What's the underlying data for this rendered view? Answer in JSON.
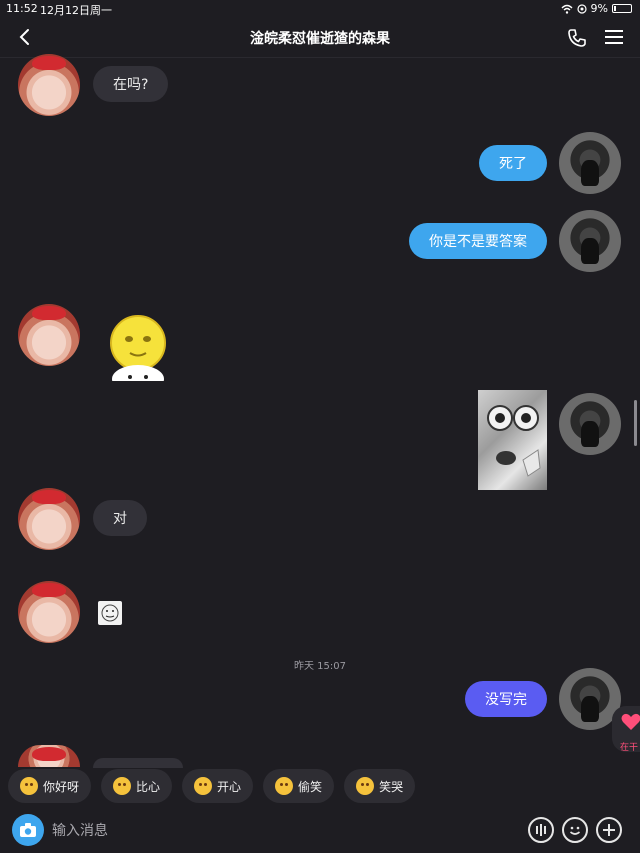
{
  "status": {
    "time": "11:52",
    "date": "12月12日周一",
    "battery": "9%"
  },
  "header": {
    "title": "淦皖柔怼催逝猹的森果"
  },
  "messages": {
    "m1": "在吗?",
    "m2": "死了",
    "m3": "你是不是要答案",
    "m4": "对",
    "m5": "没写完"
  },
  "timestamp": "昨天 15:07",
  "float_badge": {
    "label": "在干"
  },
  "quick_replies": [
    {
      "label": "你好呀"
    },
    {
      "label": "比心"
    },
    {
      "label": "开心"
    },
    {
      "label": "偷笑"
    },
    {
      "label": "笑哭"
    }
  ],
  "input": {
    "placeholder": "输入消息"
  },
  "colors": {
    "background": "#1e1d22",
    "bubble_in": "#323138",
    "bubble_out": "#3ea6ee",
    "bubble_out_alt": "#5a5cf2"
  }
}
